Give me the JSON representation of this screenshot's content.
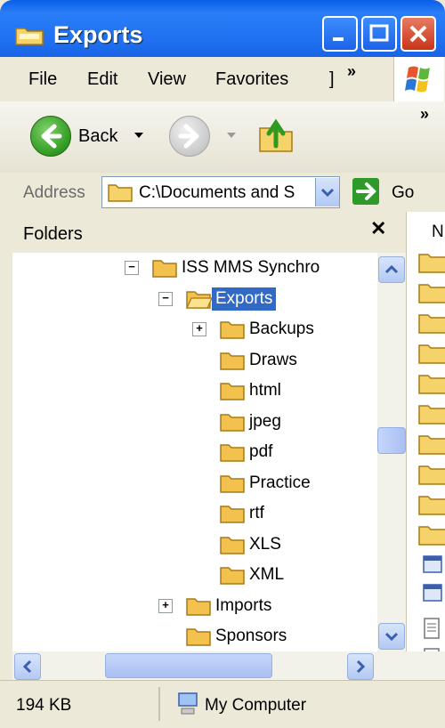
{
  "window": {
    "title": "Exports"
  },
  "menu": {
    "items": [
      "File",
      "Edit",
      "View",
      "Favorites",
      "]"
    ],
    "overflow": "»"
  },
  "toolbar": {
    "back_label": "Back",
    "overflow": "»"
  },
  "address": {
    "label": "Address",
    "value": "C:\\Documents and S",
    "go_label": "Go"
  },
  "folders_pane": {
    "title": "Folders",
    "close_glyph": "✕",
    "tree": [
      {
        "label": "ISS MMS Synchro",
        "toggle": "−",
        "indent": 0
      },
      {
        "label": "Exports",
        "toggle": "−",
        "indent": 1,
        "selected": true
      },
      {
        "label": "Backups",
        "toggle": "+",
        "indent": 2
      },
      {
        "label": "Draws",
        "toggle": "",
        "indent": 2
      },
      {
        "label": "html",
        "toggle": "",
        "indent": 2
      },
      {
        "label": "jpeg",
        "toggle": "",
        "indent": 2
      },
      {
        "label": "pdf",
        "toggle": "",
        "indent": 2
      },
      {
        "label": "Practice",
        "toggle": "",
        "indent": 2
      },
      {
        "label": "rtf",
        "toggle": "",
        "indent": 2
      },
      {
        "label": "XLS",
        "toggle": "",
        "indent": 2
      },
      {
        "label": "XML",
        "toggle": "",
        "indent": 2
      },
      {
        "label": "Imports",
        "toggle": "+",
        "indent": 1
      },
      {
        "label": "Sponsors",
        "toggle": "",
        "indent": 1
      }
    ]
  },
  "right_pane": {
    "header_fragment": "N"
  },
  "status": {
    "size": "194 KB",
    "location": "My Computer"
  },
  "colors": {
    "titlebar": "#1f6ff0",
    "selection": "#316ac5",
    "folder": "#f2c14e"
  }
}
